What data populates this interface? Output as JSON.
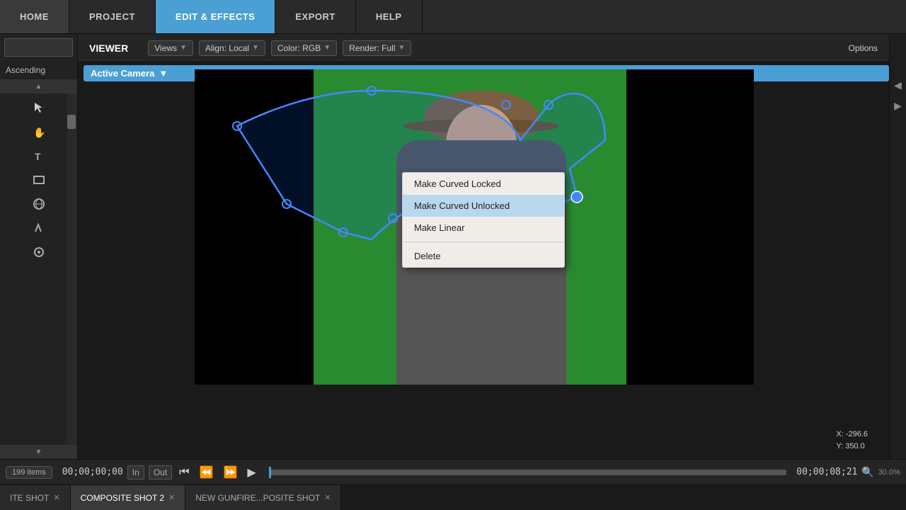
{
  "nav": {
    "items": [
      {
        "label": "HOME",
        "active": false
      },
      {
        "label": "PROJECT",
        "active": false
      },
      {
        "label": "EDIT & EFFECTS",
        "active": true
      },
      {
        "label": "EXPORT",
        "active": false
      },
      {
        "label": "HELP",
        "active": false
      }
    ]
  },
  "viewer": {
    "label": "VIEWER",
    "camera_label": "Active Camera",
    "views_label": "Views",
    "align_label": "Align: Local",
    "color_label": "Color: RGB",
    "render_label": "Render: Full",
    "options_label": "Options"
  },
  "context_menu": {
    "items": [
      {
        "label": "Make Curved Locked",
        "hovered": false
      },
      {
        "label": "Make Curved Unlocked",
        "hovered": true
      },
      {
        "label": "Make Linear",
        "hovered": false
      },
      {
        "label": "Delete",
        "hovered": false
      }
    ]
  },
  "sidebar": {
    "ascending_label": "Ascending"
  },
  "timeline": {
    "items_count": "199 items",
    "timecode_start": "00;00;00;00",
    "timecode_end": "00;00;08;21",
    "in_label": "In",
    "out_label": "Out",
    "zoom_level": "30.0%"
  },
  "tabs": [
    {
      "label": "ITE SHOT",
      "active": false
    },
    {
      "label": "COMPOSITE SHOT 2",
      "active": true
    },
    {
      "label": "NEW GUNFIRE...POSITE SHOT",
      "active": false
    }
  ],
  "coords": {
    "x": "X:  -296.6",
    "y": "Y:  350.0"
  }
}
